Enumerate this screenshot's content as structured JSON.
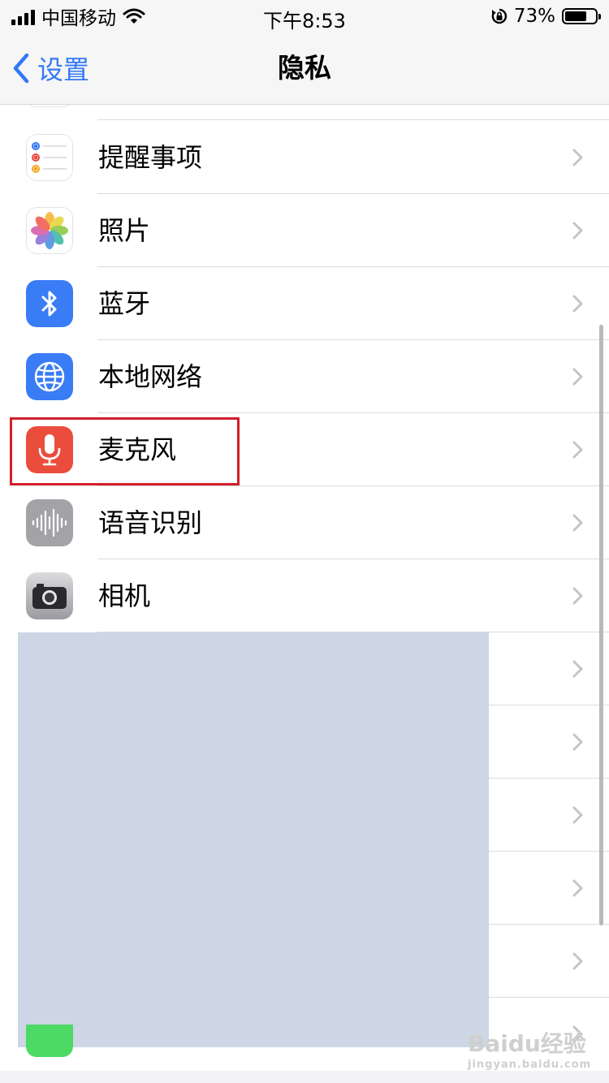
{
  "status_bar": {
    "carrier": "中国移动",
    "time": "下午8:53",
    "battery_percent": "73%",
    "battery_level": 0.73
  },
  "nav": {
    "back_label": "设置",
    "title": "隐私"
  },
  "rows": [
    {
      "label": "提醒事项",
      "icon": "reminders-icon"
    },
    {
      "label": "照片",
      "icon": "photos-icon"
    },
    {
      "label": "蓝牙",
      "icon": "bluetooth-icon"
    },
    {
      "label": "本地网络",
      "icon": "local-network-icon"
    },
    {
      "label": "麦克风",
      "icon": "microphone-icon",
      "highlighted": true
    },
    {
      "label": "语音识别",
      "icon": "speech-recognition-icon"
    },
    {
      "label": "相机",
      "icon": "camera-icon"
    }
  ],
  "watermark": {
    "main": "Baidu经验",
    "sub": "jingyan.baidu.com"
  },
  "colors": {
    "accent": "#3478f6",
    "highlight": "#d21f2a",
    "redaction": "#cdd6e4"
  }
}
